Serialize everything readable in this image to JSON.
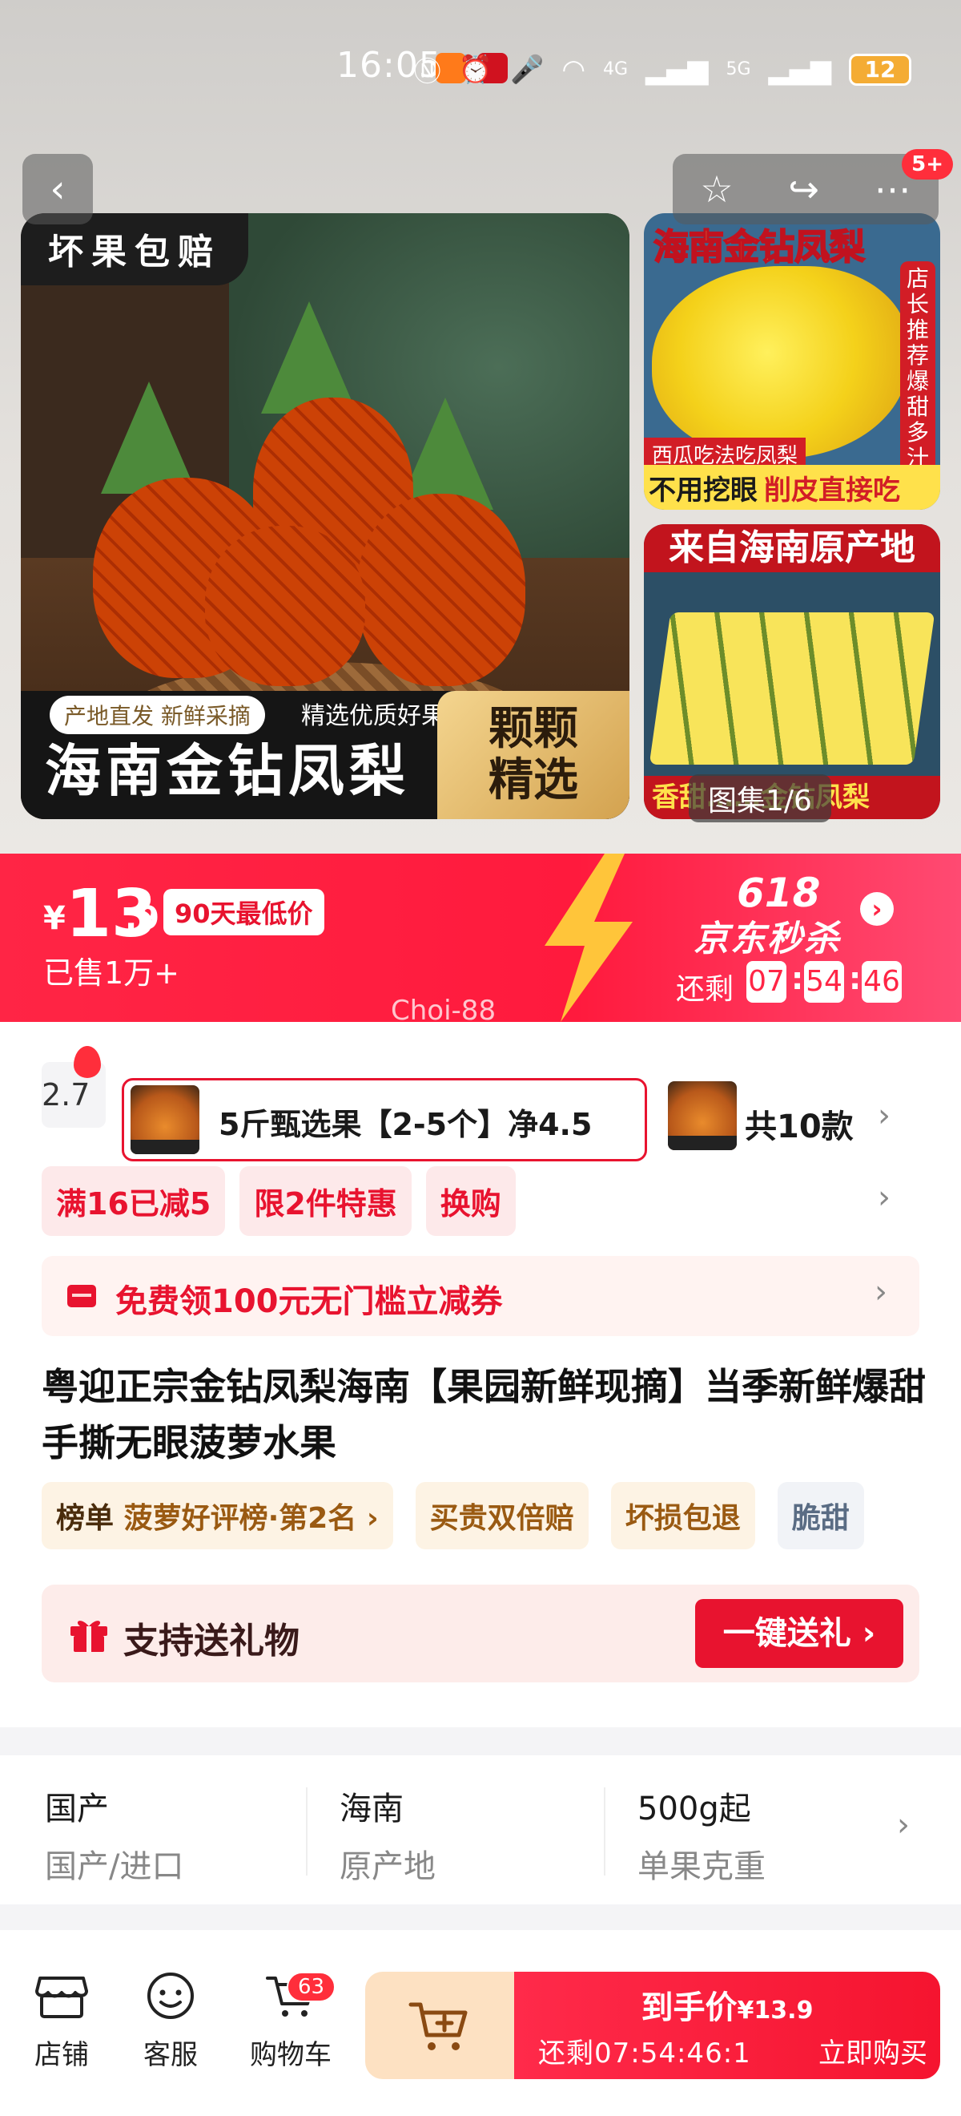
{
  "status_bar": {
    "time": "16:05",
    "network": "5G",
    "lte": "4G",
    "battery": "12"
  },
  "header": {
    "notification_count": "5+",
    "gallery_counter": "图集1/6"
  },
  "gallery": {
    "main": {
      "top_tag": "坏果包赔",
      "sub_pill": "产地直发 新鲜采摘",
      "sub_text": "精选优质好果",
      "big_title": "海南金钻凤梨",
      "gold_line1": "颗颗",
      "gold_line2": "精选"
    },
    "side1": {
      "title": "海南金钻凤梨",
      "vertical_badge": "店长推荐爆甜多汁",
      "red_tag": "西瓜吃法吃凤梨",
      "band_left": "不用挖眼",
      "band_right": "削皮直接吃"
    },
    "side2": {
      "title": "来自海南原产地",
      "band": "香甜……金钻凤梨"
    }
  },
  "price_banner": {
    "currency": "¥",
    "price_int": "13",
    "price_dec": ".9",
    "lowest_badge": "90天最低价",
    "sold": "已售1万+",
    "event_618": "618",
    "event_name": "京东秒杀",
    "remain_label": "还剩",
    "hh": "07",
    "mm": "54",
    "ss": "46",
    "watermark": "Choi-88"
  },
  "sku": {
    "prev_price": "2.7",
    "selected_label": "5斤甄选果【2-5个】净4.5",
    "total": "共10款"
  },
  "promos": [
    "满16已减5",
    "限2件特惠",
    "换购"
  ],
  "coupon": {
    "text": "免费领100元无门槛立减券"
  },
  "product_title": "粤迎正宗金钻凤梨海南【果园新鲜现摘】当季新鲜爆甜手撕无眼菠萝水果",
  "tags": {
    "rank_key": "榜单",
    "rank_value": "菠萝好评榜·第2名 ›",
    "t1": "买贵双倍赔",
    "t2": "坏损包退",
    "t3": "脆甜"
  },
  "gift": {
    "text": "支持送礼物",
    "button": "一键送礼 ›"
  },
  "specs": [
    {
      "value": "国产",
      "label": "国产/进口"
    },
    {
      "value": "海南",
      "label": "原产地"
    },
    {
      "value": "500g起",
      "label": "单果克重"
    }
  ],
  "bottom_bar": {
    "shop": "店铺",
    "service": "客服",
    "cart": "购物车",
    "cart_count": "63",
    "buy_line1": "到手价",
    "buy_price": "¥13.9",
    "buy_remain": "还剩07:54:46:1",
    "buy_now": "立即购买"
  },
  "colors": {
    "brand_red": "#e8132f",
    "banner_red": "#ff2545",
    "gold": "#d3a24f"
  }
}
